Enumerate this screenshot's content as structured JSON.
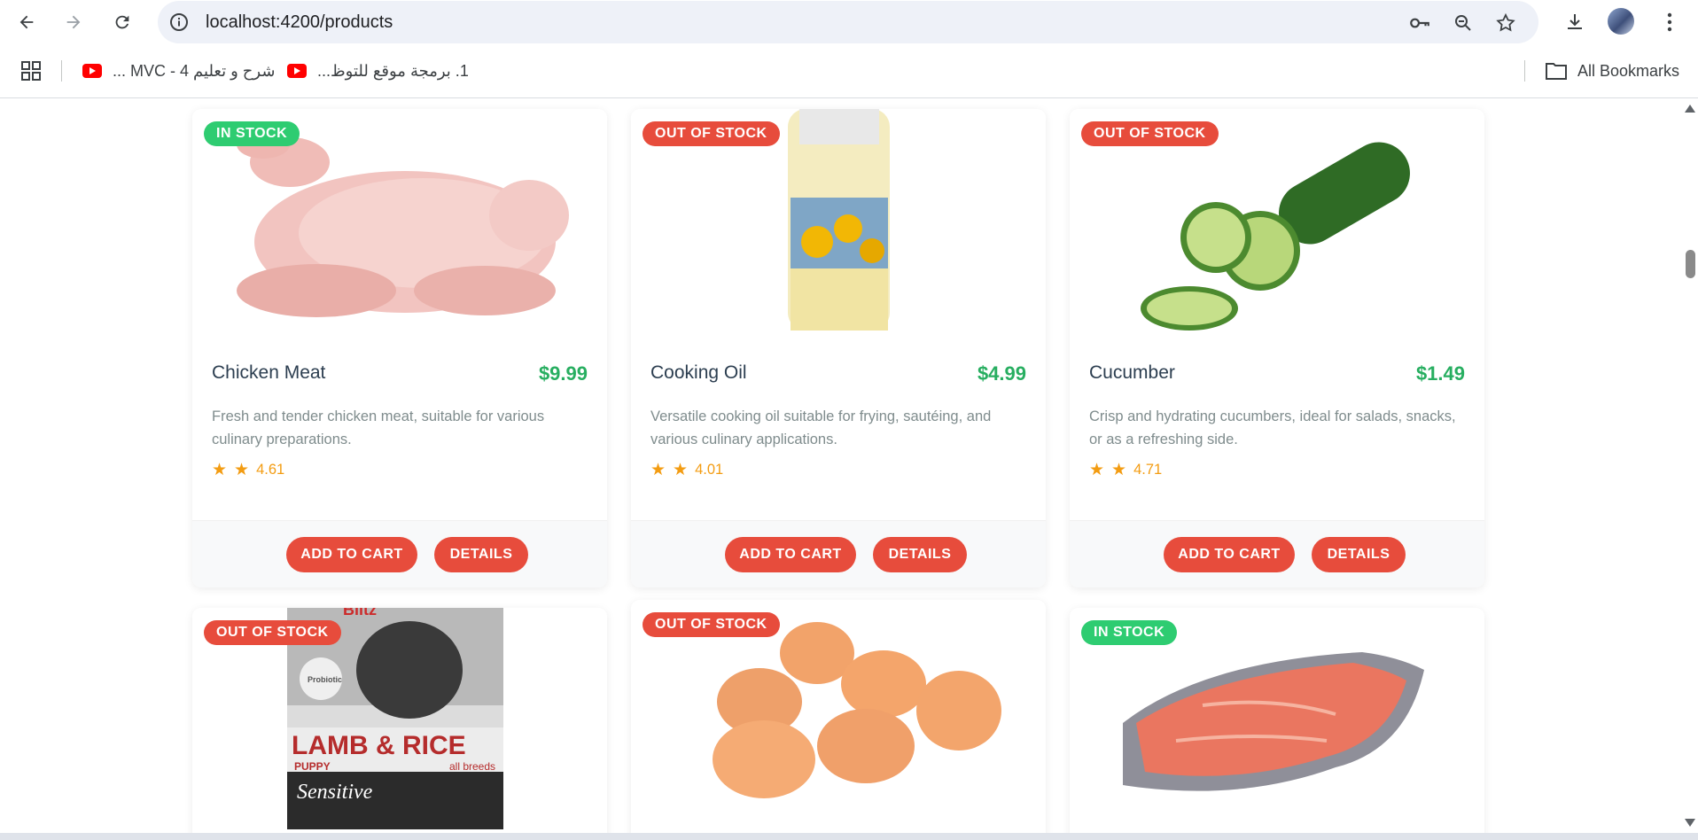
{
  "browser": {
    "url": "localhost:4200/products"
  },
  "bookmarks": {
    "items": [
      {
        "label": "شرح و تعليم MVC - 4 ...",
        "icon": "youtube-icon"
      },
      {
        "label": "1. برمجة موقع للتوظ...",
        "icon": "youtube-icon"
      }
    ],
    "all_bookmarks_label": "All Bookmarks"
  },
  "colors": {
    "in_stock": "#2ecc71",
    "out_of_stock": "#e74c3c",
    "price": "#27ae60",
    "rating": "#f39c12",
    "button": "#e74c3c"
  },
  "products": [
    {
      "name": "Chicken Meat",
      "price": "$9.99",
      "status": "IN STOCK",
      "description": "Fresh and tender chicken meat, suitable for various culinary preparations.",
      "rating": "4.61",
      "add_label": "ADD TO CART",
      "details_label": "DETAILS"
    },
    {
      "name": "Cooking Oil",
      "price": "$4.99",
      "status": "OUT OF STOCK",
      "description": "Versatile cooking oil suitable for frying, sautéing, and various culinary applications.",
      "rating": "4.01",
      "add_label": "ADD TO CART",
      "details_label": "DETAILS"
    },
    {
      "name": "Cucumber",
      "price": "$1.49",
      "status": "OUT OF STOCK",
      "description": "Crisp and hydrating cucumbers, ideal for salads, snacks, or as a refreshing side.",
      "rating": "4.71",
      "add_label": "ADD TO CART",
      "details_label": "DETAILS"
    },
    {
      "status": "OUT OF STOCK",
      "image_text_1": "LAMB & RICE",
      "image_text_2": "PUPPY",
      "image_text_3": "all breeds",
      "image_text_4": "Sensitive",
      "image_text_5": "Probiotic",
      "image_text_6": "Blitz"
    },
    {
      "status": "OUT OF STOCK"
    },
    {
      "status": "IN STOCK"
    }
  ]
}
